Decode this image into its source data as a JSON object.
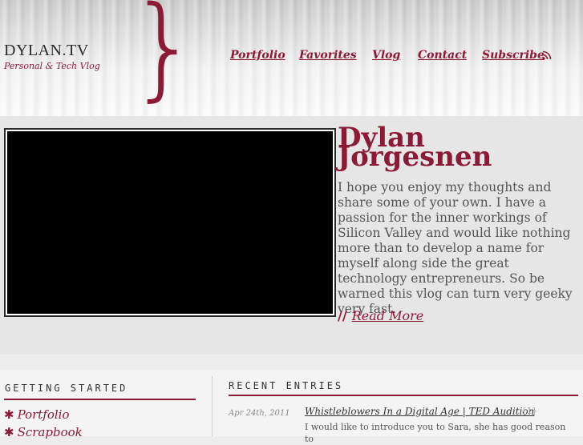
{
  "site": {
    "title": "DYLAN.TV",
    "tagline": "Personal & Tech Vlog",
    "brace": "}"
  },
  "nav": {
    "items": [
      "Portfolio",
      "Favorites",
      "Vlog",
      "Contact",
      "Subscribe"
    ]
  },
  "hero": {
    "name_first": "Dylan",
    "name_last": "Jorgesnen",
    "intro": "I hope you enjoy my thoughts and share some of your own. I have a passion for the inner workings of Silicon Valley and would like nothing more than to develop a name for myself along side the great technology entrepreneurs. So be warned this vlog can turn very geeky very fast.",
    "read_more_prefix": "//",
    "read_more": "Read More"
  },
  "sidebar": {
    "heading": "GETTING STARTED",
    "items": [
      "Portfolio",
      "Scrapbook"
    ]
  },
  "recent": {
    "heading": "RECENT ENTRIES",
    "entries": [
      {
        "date": "Apr 24th, 2011",
        "title": "Whistleblowers In a Digital Age | TED Audition",
        "comments": "{1}",
        "excerpt": "I would like to introduce you to Sara, she has good reason to"
      }
    ]
  },
  "colors": {
    "accent": "#8b1a34",
    "background": "#ececec"
  }
}
